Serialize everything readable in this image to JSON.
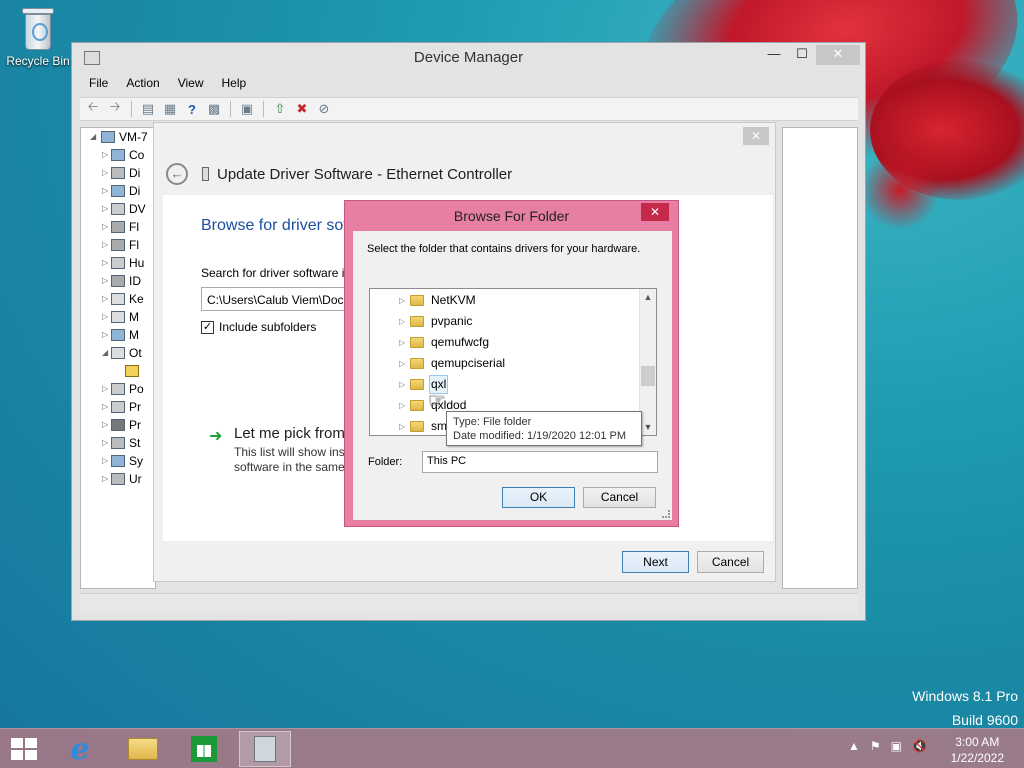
{
  "desktop": {
    "recycle_bin_label": "Recycle Bin",
    "watermark_line1": "Windows 8.1 Pro",
    "watermark_line2": "Build 9600"
  },
  "device_manager": {
    "title": "Device Manager",
    "menu": [
      "File",
      "Action",
      "View",
      "Help"
    ],
    "toolbar_icons": [
      "back-icon",
      "forward-icon",
      "properties-icon",
      "view-icon",
      "help-icon",
      "view2-icon",
      "scan-hardware-icon",
      "update-driver-icon",
      "uninstall-icon",
      "disable-icon"
    ],
    "tree": {
      "root": "VM-7",
      "items": [
        "Co",
        "Di",
        "Di",
        "DV",
        "Fl",
        "Fl",
        "Hu",
        "ID",
        "Ke",
        "M",
        "M",
        "Ot",
        "",
        "Po",
        "Pr",
        "Pr",
        "St",
        "Sy",
        "Ur"
      ]
    }
  },
  "wizard": {
    "title": "Update Driver Software - Ethernet Controller",
    "heading": "Browse for driver sof",
    "search_label": "Search for driver software ir",
    "path_value": "C:\\Users\\Calub Viem\\Docu",
    "include_subfolders_label": "Include subfolders",
    "include_subfolders_checked": true,
    "pick_title": "Let me pick from",
    "pick_desc_line1": "This list will show inst",
    "pick_desc_line2": "software in the same",
    "next_label": "Next",
    "cancel_label": "Cancel"
  },
  "browse_folder": {
    "title": "Browse For Folder",
    "instruction": "Select the folder that contains drivers for your hardware.",
    "folders": [
      "NetKVM",
      "pvpanic",
      "qemufwcfg",
      "qemupciserial",
      "qxl",
      "qxldod",
      "sm"
    ],
    "selected_folder": "qxl",
    "tooltip_type": "Type: File folder",
    "tooltip_modified": "Date modified: 1/19/2020 12:01 PM",
    "folder_label": "Folder:",
    "folder_value": "This PC",
    "ok_label": "OK",
    "cancel_label": "Cancel"
  },
  "taskbar": {
    "time": "3:00 AM",
    "date": "1/22/2022",
    "tray_icons": [
      "show-hidden-icon",
      "flag-icon",
      "network-icon",
      "volume-muted-icon"
    ]
  }
}
